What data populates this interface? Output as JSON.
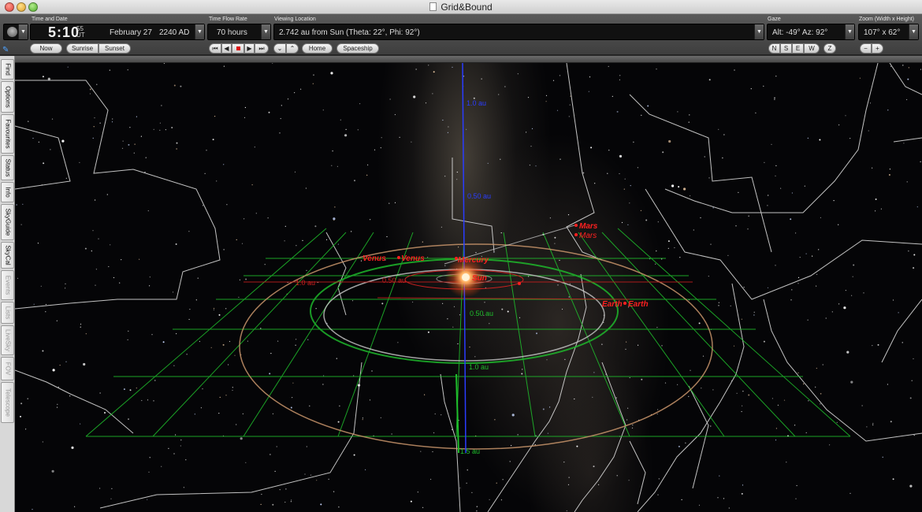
{
  "window": {
    "title": "Grid&Bound"
  },
  "toolbar": {
    "time_date": {
      "label": "Time and Date",
      "clock": "5:10",
      "seconds": "55",
      "zone": "UT",
      "date": "February 27",
      "year": "2240 AD",
      "buttons": [
        "Now",
        "Sunrise",
        "Sunset"
      ]
    },
    "time_flow": {
      "label": "Time Flow Rate",
      "value": "70 hours"
    },
    "viewing_location": {
      "label": "Viewing Location",
      "value": "2.742 au from Sun (Theta: 22°, Phi: 92°)",
      "buttons": [
        "Home",
        "Spaceship"
      ]
    },
    "gaze": {
      "label": "Gaze",
      "value": "Alt: -49° Az: 92°",
      "buttons": [
        "N",
        "S",
        "E",
        "W",
        "Z"
      ]
    },
    "zoom": {
      "label": "Zoom (Width x Height)",
      "value": "107° x 62°"
    }
  },
  "sidebar": {
    "tabs": [
      {
        "label": "Find",
        "enabled": true
      },
      {
        "label": "Options",
        "enabled": true
      },
      {
        "label": "Favourites",
        "enabled": true
      },
      {
        "label": "Status",
        "enabled": true
      },
      {
        "label": "Info",
        "enabled": true
      },
      {
        "label": "SkyGuide",
        "enabled": true
      },
      {
        "label": "SkyCal",
        "enabled": true
      },
      {
        "label": "Events",
        "enabled": false
      },
      {
        "label": "Lists",
        "enabled": false
      },
      {
        "label": "LiveSky",
        "enabled": false
      },
      {
        "label": "FOV",
        "enabled": false
      },
      {
        "label": "Telescope",
        "enabled": false
      }
    ]
  },
  "sky": {
    "planets": {
      "venus": "Venus",
      "venus2": "Venus",
      "mercury": "Mercury",
      "sun": "Sun",
      "mars": "Mars",
      "mars2": "Mars",
      "earth": "Earth",
      "earth2": "Earth"
    },
    "grid_labels": {
      "au_05_top": "0.50 au",
      "au_1_top": "1.0 au",
      "au_05": "0.50 au",
      "au_1": "1.0 au",
      "au_1_left": "1.0 au",
      "au_05_left": "0.50 au",
      "au_15": "1.5 au"
    },
    "colors": {
      "grid": "#1fbf2c",
      "orbit": "#c9c9c9",
      "planet_label": "#ff2020",
      "axis": "#2a3cff",
      "constellation": "#d8d8d8"
    }
  }
}
